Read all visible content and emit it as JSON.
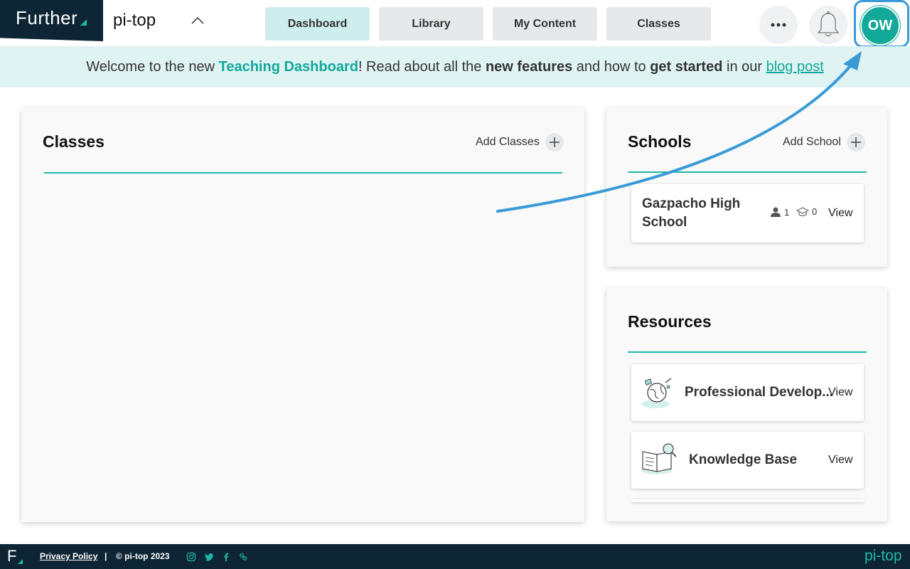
{
  "brand": {
    "name": "Further"
  },
  "org": {
    "name": "pi-top"
  },
  "nav": {
    "tabs": [
      {
        "label": "Dashboard",
        "active": true
      },
      {
        "label": "Library",
        "active": false
      },
      {
        "label": "My Content",
        "active": false
      },
      {
        "label": "Classes",
        "active": false
      }
    ],
    "more_icon": "ellipsis-icon",
    "notifications_icon": "bell-icon",
    "avatar_initials": "OW"
  },
  "banner": {
    "part1": "Welcome to the new ",
    "highlight": "Teaching Dashboard",
    "part2": "! Read about all the ",
    "bold1": "new features",
    "part3": " and how to ",
    "bold2": "get started",
    "part4": " in our ",
    "link": "blog post"
  },
  "classes_card": {
    "title": "Classes",
    "action_label": "Add Classes"
  },
  "schools_card": {
    "title": "Schools",
    "action_label": "Add School",
    "items": [
      {
        "name": "Gazpacho High School",
        "teachers": "1",
        "students": "0",
        "view_label": "View"
      }
    ]
  },
  "resources_card": {
    "title": "Resources",
    "items": [
      {
        "name": "Professional Develop...",
        "view_label": "View",
        "icon": "globe-illustration-icon"
      },
      {
        "name": "Knowledge Base",
        "view_label": "View",
        "icon": "book-magnifier-icon"
      }
    ]
  },
  "footer": {
    "brand_letter": "F",
    "privacy_label": "Privacy Policy",
    "separator": "|",
    "copyright": "© pi-top 2023",
    "brand_name": "pi-top"
  },
  "colors": {
    "teal": "#12a89a",
    "navy": "#0d2535",
    "annotation_blue": "#3a9ad6"
  }
}
